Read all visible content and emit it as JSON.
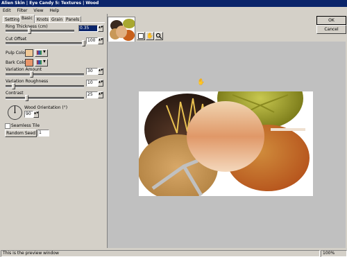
{
  "window": {
    "title": "Alien Skin | Eye Candy 5: Textures | Wood"
  },
  "menu": [
    "Edit",
    "Filter",
    "View",
    "Help"
  ],
  "tabs": [
    "Settings",
    "Basic",
    "Knots",
    "Grain",
    "Panels"
  ],
  "controls": {
    "ring_thickness": {
      "label": "Ring Thickness (cm)",
      "value": "0.35",
      "level": 0.33
    },
    "cut_offset": {
      "label": "Cut Offset",
      "value": "100",
      "level": 1.0
    },
    "pulp_color": {
      "label": "Pulp Color",
      "color": "#f0c896"
    },
    "bark_color": {
      "label": "Bark Color",
      "color": "#e8956a"
    },
    "variation_amount": {
      "label": "Variation Amount",
      "value": "30",
      "level": 0.3
    },
    "variation_roughness": {
      "label": "Variation Roughness",
      "value": "10",
      "level": 0.1
    },
    "contrast": {
      "label": "Contrast",
      "value": "25",
      "level": 0.25
    },
    "wood_orientation": {
      "label": "Wood Orientation (°)",
      "value": "90"
    },
    "seamless_tile": {
      "label": "Seamless Tile",
      "checked": false
    },
    "random_seed": {
      "label": "Random Seed",
      "value": "1"
    }
  },
  "buttons": {
    "ok": "OK",
    "cancel": "Cancel"
  },
  "status": {
    "text": "This is the preview window",
    "zoom": "100%"
  },
  "colors": {
    "titlebar": "#0a246a",
    "selection": "#0a246a",
    "preview_bg": "#ffffff"
  }
}
